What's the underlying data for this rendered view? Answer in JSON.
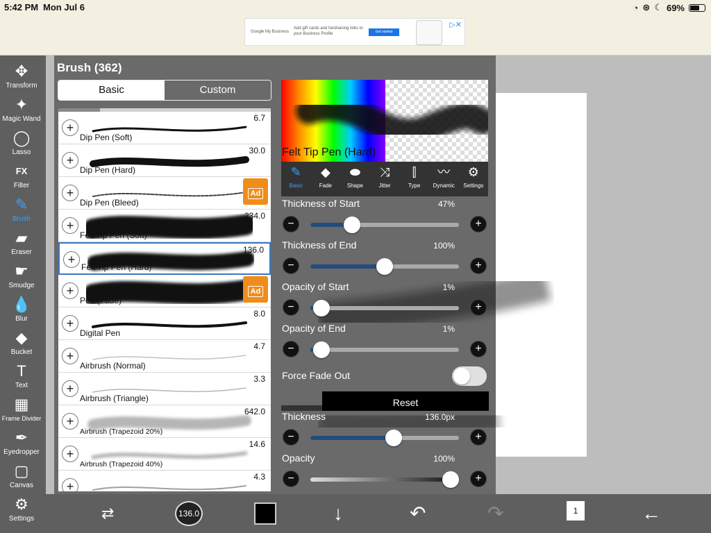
{
  "status": {
    "time": "5:42 PM",
    "date": "Mon Jul 6",
    "battery": "69%",
    "battery_fraction": 0.69
  },
  "ad": {
    "brand": "Google My Business",
    "message": "Add gift cards and fundraising links to your Business Profile",
    "button": "Get started"
  },
  "toolbar": [
    {
      "name": "transform",
      "label": "Transform",
      "icon": "✥"
    },
    {
      "name": "magic-wand",
      "label": "Magic Wand",
      "icon": "✦"
    },
    {
      "name": "lasso",
      "label": "Lasso",
      "icon": "◯"
    },
    {
      "name": "filter",
      "label": "Filter",
      "icon": "FX"
    },
    {
      "name": "brush",
      "label": "Brush",
      "icon": "✎",
      "active": true
    },
    {
      "name": "eraser",
      "label": "Eraser",
      "icon": "▰"
    },
    {
      "name": "smudge",
      "label": "Smudge",
      "icon": "☛"
    },
    {
      "name": "blur",
      "label": "Blur",
      "icon": "💧"
    },
    {
      "name": "bucket",
      "label": "Bucket",
      "icon": "◆"
    },
    {
      "name": "text",
      "label": "Text",
      "icon": "T"
    },
    {
      "name": "frame-divider",
      "label": "Frame Divider",
      "icon": "▦"
    },
    {
      "name": "eyedropper",
      "label": "Eyedropper",
      "icon": "✒"
    },
    {
      "name": "canvas",
      "label": "Canvas",
      "icon": "▢"
    },
    {
      "name": "settings",
      "label": "Settings",
      "icon": "⚙"
    }
  ],
  "panel": {
    "title": "Brush (362)",
    "tabs": {
      "basic": "Basic",
      "custom": "Custom"
    },
    "brushes": [
      {
        "name": "Dip Pen (Soft)",
        "size": "6.7"
      },
      {
        "name": "Dip Pen (Hard)",
        "size": "30.0"
      },
      {
        "name": "Dip Pen (Bleed)",
        "size": "",
        "ad": true
      },
      {
        "name": "Felt Tip Pen (Soft)",
        "size": "234.0"
      },
      {
        "name": "Felt Tip Pen (Hard)",
        "size": "136.0",
        "selected": true
      },
      {
        "name": "Pen (Fade)",
        "size": "",
        "ad": true
      },
      {
        "name": "Digital Pen",
        "size": "8.0"
      },
      {
        "name": "Airbrush (Normal)",
        "size": "4.7"
      },
      {
        "name": "Airbrush (Triangle)",
        "size": "3.3"
      },
      {
        "name": "Airbrush (Trapezoid 20%)",
        "size": "642.0"
      },
      {
        "name": "Airbrush (Trapezoid 40%)",
        "size": "14.6"
      },
      {
        "name": "",
        "size": "4.3"
      }
    ],
    "ad_badge": "Ad",
    "preview_name": "Felt Tip Pen (Hard)",
    "setting_tabs": [
      "Basic",
      "Fade",
      "Shape",
      "Jitter",
      "Type",
      "Dynamic",
      "Settings"
    ],
    "settings": [
      {
        "label": "Thickness of Start",
        "value": "47%",
        "fraction": 0.25
      },
      {
        "label": "Thickness of End",
        "value": "100%",
        "fraction": 0.5
      },
      {
        "label": "Opacity of Start",
        "value": "1%",
        "fraction": 0.02
      },
      {
        "label": "Opacity of End",
        "value": "1%",
        "fraction": 0.02
      }
    ],
    "force_fade_out": "Force Fade Out",
    "reset": "Reset",
    "thickness": {
      "label": "Thickness",
      "value": "136.0px",
      "fraction": 0.57
    },
    "opacity": {
      "label": "Opacity",
      "value": "100%",
      "fraction": 1.0
    }
  },
  "bottom": {
    "brush_size": "136.0",
    "page_count": "1"
  }
}
